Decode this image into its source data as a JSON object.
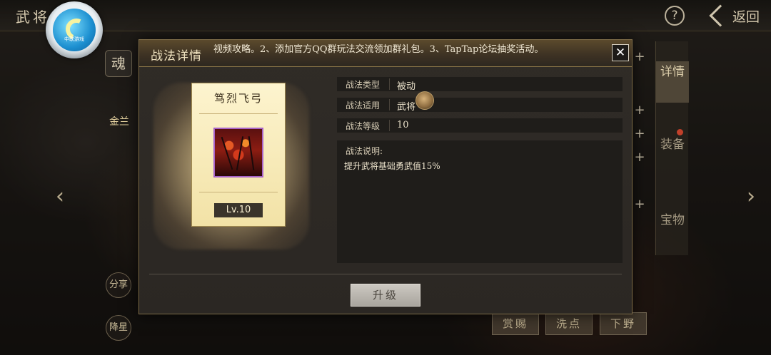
{
  "topbar": {
    "title": "武将",
    "help_icon": "?",
    "back_label": "返回"
  },
  "logo": {
    "text": "中联游戏"
  },
  "side": {
    "soul_badge": "魂",
    "gold_text": "金兰",
    "share_label": "分享",
    "descend_label": "降星"
  },
  "right_tabs": {
    "detail": "详情",
    "equip": "装备",
    "treasure": "宝物"
  },
  "bottom_buttons": {
    "reward": "赏赐",
    "wash": "洗点",
    "retire": "下野"
  },
  "modal": {
    "title": "战法详情",
    "marquee": "视频攻略。2、添加官方QQ群玩法交流领加群礼包。3、TapTap论坛抽奖活动。",
    "close_icon": "✕",
    "skill_card": {
      "name": "笃烈飞弓",
      "level": "Lv.10"
    },
    "info": [
      {
        "label": "战法类型",
        "value": "被动"
      },
      {
        "label": "战法适用",
        "value": "武将"
      },
      {
        "label": "战法等级",
        "value": "10"
      }
    ],
    "description_label": "战法说明:",
    "description_text": "提升武将基础勇武值15%",
    "upgrade_label": "升级"
  }
}
